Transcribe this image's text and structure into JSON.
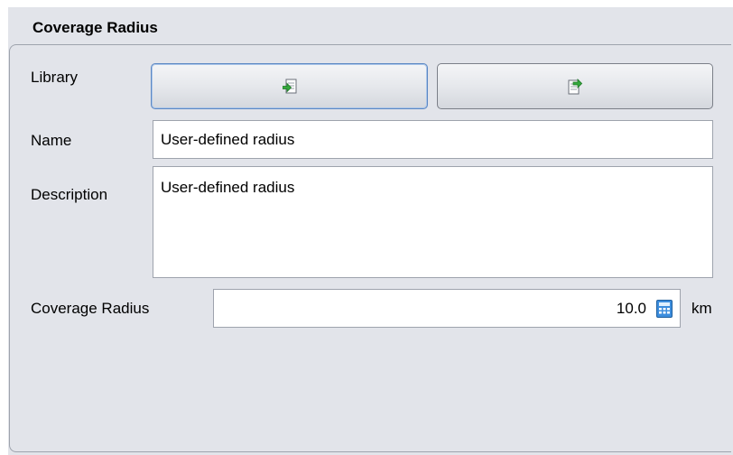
{
  "group": {
    "title": "Coverage Radius"
  },
  "library": {
    "label": "Library",
    "import_icon": "import-from-library-icon",
    "export_icon": "export-to-library-icon"
  },
  "name": {
    "label": "Name",
    "value": "User-defined radius"
  },
  "description": {
    "label": "Description",
    "value": "User-defined radius"
  },
  "coverage_radius": {
    "label": "Coverage Radius",
    "value": "10.0",
    "unit": "km",
    "calculator_icon": "calculator-icon"
  },
  "colors": {
    "panel_background": "#e2e4ea",
    "focus_border": "#5c88c4",
    "icon_green": "#34a83c",
    "icon_blue": "#3c8ddd"
  }
}
